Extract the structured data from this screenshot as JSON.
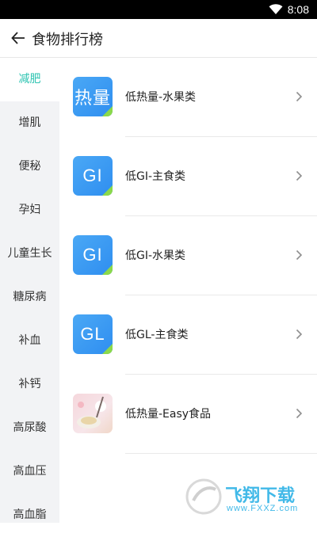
{
  "status_bar": {
    "time": "8:08",
    "icon": "wifi-icon"
  },
  "header": {
    "title": "食物排行榜",
    "back_icon": "back-arrow-icon"
  },
  "sidebar": {
    "items": [
      {
        "label": "减肥",
        "active": true
      },
      {
        "label": "增肌"
      },
      {
        "label": "便秘"
      },
      {
        "label": "孕妇"
      },
      {
        "label": "儿童生长"
      },
      {
        "label": "糖尿病"
      },
      {
        "label": "补血"
      },
      {
        "label": "补钙"
      },
      {
        "label": "高尿酸"
      },
      {
        "label": "高血压"
      },
      {
        "label": "高血脂"
      }
    ]
  },
  "list": {
    "items": [
      {
        "tile_text": "热量",
        "label": "低热量-水果类"
      },
      {
        "tile_text": "GI",
        "label": "低GI-主食类"
      },
      {
        "tile_text": "GI",
        "label": "低GI-水果类"
      },
      {
        "tile_text": "GL",
        "label": "低GL-主食类"
      },
      {
        "tile_image": "food-photo-thumbnail",
        "label": "低热量-Easy食品"
      }
    ]
  },
  "watermark": {
    "text": "飞翔下载",
    "url": "www.FXXZ.com"
  },
  "colors": {
    "accent": "#2fc4b2",
    "tile_blue": "#3a9af2",
    "tile_corner": "#8bd94a",
    "sidebar_bg": "#f2f3f5"
  }
}
